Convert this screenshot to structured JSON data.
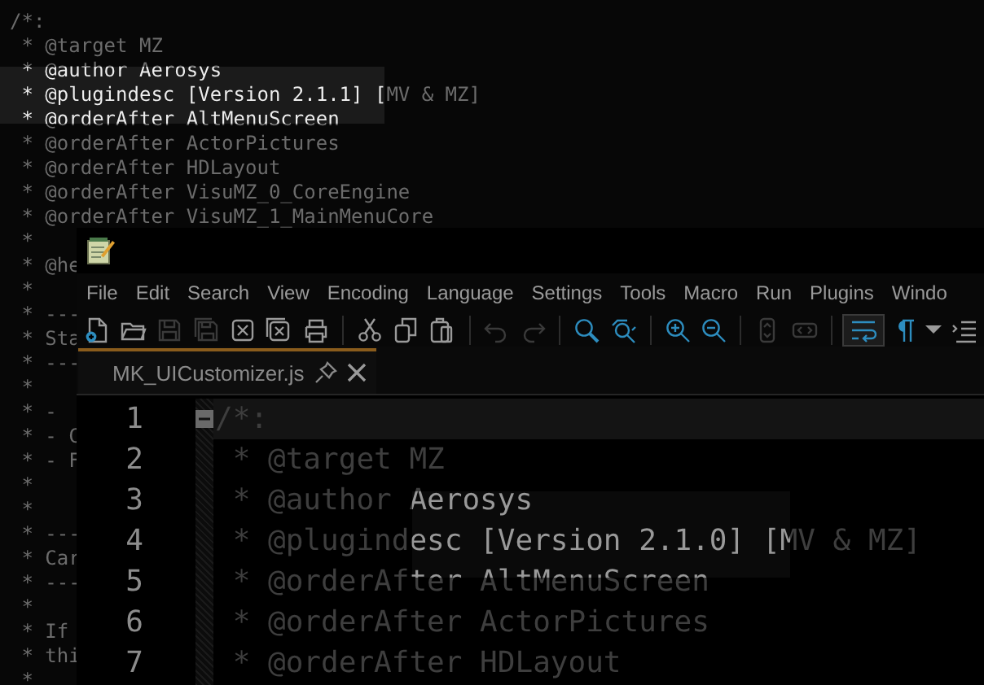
{
  "background_editor": {
    "lines": [
      "/*:",
      " * @target MZ",
      " * @author Aerosys",
      " * @plugindesc [Version 2.1.1] [MV & MZ]",
      " * @orderAfter AltMenuScreen",
      " * @orderAfter ActorPictures",
      " * @orderAfter HDLayout",
      " * @orderAfter VisuMZ_0_CoreEngine",
      " * @orderAfter VisuMZ_1_MainMenuCore",
      " *",
      " * @he",
      " *",
      " * ---",
      " * Sta",
      " * ---",
      " *",
      " * -",
      " * - C",
      " * - F",
      " *",
      " *",
      " * ---",
      " * Car",
      " * ---",
      " *",
      " * If",
      " * thi",
      " *"
    ]
  },
  "notepad_window": {
    "menu": [
      "File",
      "Edit",
      "Search",
      "View",
      "Encoding",
      "Language",
      "Settings",
      "Tools",
      "Macro",
      "Run",
      "Plugins",
      "Windo"
    ],
    "toolbar_groups": [
      {
        "buttons": [
          {
            "kind": "new",
            "disabled": false,
            "selected": false
          },
          {
            "kind": "open",
            "disabled": false,
            "selected": false
          },
          {
            "kind": "save",
            "disabled": true,
            "selected": false
          },
          {
            "kind": "save-all",
            "disabled": true,
            "selected": false
          },
          {
            "kind": "close",
            "disabled": false,
            "selected": false
          },
          {
            "kind": "close-all",
            "disabled": false,
            "selected": false
          },
          {
            "kind": "print",
            "disabled": false,
            "selected": false
          }
        ]
      },
      {
        "buttons": [
          {
            "kind": "cut",
            "disabled": false,
            "selected": false
          },
          {
            "kind": "copy",
            "disabled": false,
            "selected": false
          },
          {
            "kind": "paste",
            "disabled": false,
            "selected": false
          }
        ]
      },
      {
        "buttons": [
          {
            "kind": "undo",
            "disabled": true,
            "selected": false
          },
          {
            "kind": "redo",
            "disabled": true,
            "selected": false
          }
        ]
      },
      {
        "buttons": [
          {
            "kind": "find",
            "disabled": false,
            "selected": false
          },
          {
            "kind": "replace",
            "disabled": false,
            "selected": false
          }
        ]
      },
      {
        "buttons": [
          {
            "kind": "zoom-in",
            "disabled": false,
            "selected": false
          },
          {
            "kind": "zoom-out",
            "disabled": false,
            "selected": false
          }
        ]
      },
      {
        "buttons": [
          {
            "kind": "sync-vertical",
            "disabled": true,
            "selected": false
          },
          {
            "kind": "sync-horizontal",
            "disabled": true,
            "selected": false
          }
        ]
      },
      {
        "buttons": [
          {
            "kind": "word-wrap",
            "disabled": false,
            "selected": true
          },
          {
            "kind": "show-all-characters",
            "disabled": false,
            "selected": false
          },
          {
            "kind": "dropdown",
            "disabled": false,
            "selected": false
          },
          {
            "kind": "indent-guide",
            "disabled": false,
            "selected": false
          }
        ]
      }
    ],
    "tab": {
      "label": "MK_UICustomizer.js",
      "selected": true
    },
    "editor_lines": [
      {
        "number": "1",
        "text": "/*:",
        "current": true,
        "fold": true
      },
      {
        "number": "2",
        "text": " * @target MZ",
        "current": false,
        "fold": false
      },
      {
        "number": "3",
        "text": " * @author Aerosys",
        "current": false,
        "fold": false
      },
      {
        "number": "4",
        "text": " * @plugindesc [Version 2.1.0] [MV & MZ]",
        "current": false,
        "fold": false
      },
      {
        "number": "5",
        "text": " * @orderAfter AltMenuScreen",
        "current": false,
        "fold": false
      },
      {
        "number": "6",
        "text": " * @orderAfter ActorPictures",
        "current": false,
        "fold": false
      },
      {
        "number": "7",
        "text": " * @orderAfter HDLayout",
        "current": false,
        "fold": false
      }
    ]
  }
}
